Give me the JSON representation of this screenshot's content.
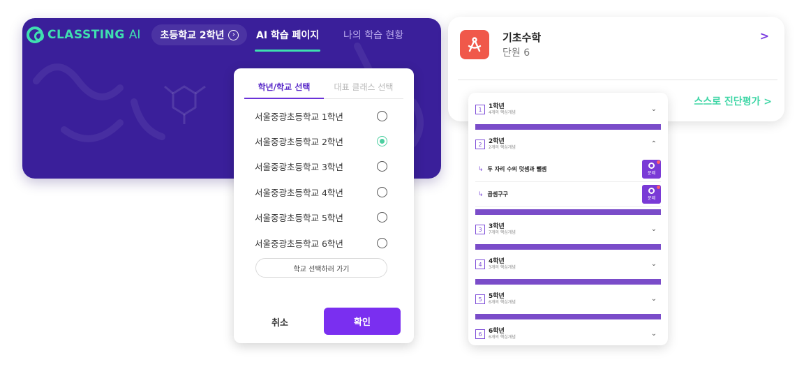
{
  "app": {
    "logo_text": "CLASSTING",
    "logo_ai": "AI",
    "grade_pill": "초등학교 2학년",
    "nav": {
      "active": "AI 학습 페이지",
      "inactive": "나의 학습 현황"
    },
    "accent_color": "#3fe0b0",
    "bg_color": "#3a1f9a"
  },
  "modal": {
    "tabs": [
      "학년/학교 선택",
      "대표 클래스 선택"
    ],
    "schools": [
      {
        "name": "서울중광초등학교 1학년",
        "selected": false
      },
      {
        "name": "서울중광초등학교 2학년",
        "selected": true
      },
      {
        "name": "서울중광초등학교 3학년",
        "selected": false
      },
      {
        "name": "서울중광초등학교 4학년",
        "selected": false
      },
      {
        "name": "서울중광초등학교 5학년",
        "selected": false
      },
      {
        "name": "서울중광초등학교 6학년",
        "selected": false
      }
    ],
    "school_select_label": "학교 선택하러 가기",
    "cancel_label": "취소",
    "confirm_label": "확인"
  },
  "course": {
    "title": "기초수학",
    "unit": "단원 6",
    "self_diagnosis": "스스로 진단평가 >",
    "chevron": ">"
  },
  "grades": [
    {
      "num": "1",
      "title": "1학년",
      "sub": "4개의 핵심개념",
      "expanded": false,
      "concepts": []
    },
    {
      "num": "2",
      "title": "2학년",
      "sub": "2개의 핵심개념",
      "expanded": true,
      "concepts": [
        {
          "name": "두 자리 수의 덧셈과 뺄셈",
          "button_label": "문제"
        },
        {
          "name": "곱셈구구",
          "button_label": "문제"
        }
      ]
    },
    {
      "num": "3",
      "title": "3학년",
      "sub": "7개의 핵심개념",
      "expanded": false,
      "concepts": []
    },
    {
      "num": "4",
      "title": "4학년",
      "sub": "3개의 핵심개념",
      "expanded": false,
      "concepts": []
    },
    {
      "num": "5",
      "title": "5학년",
      "sub": "6개의 핵심개념",
      "expanded": false,
      "concepts": []
    },
    {
      "num": "6",
      "title": "6학년",
      "sub": "6개의 핵심개념",
      "expanded": false,
      "concepts": []
    }
  ]
}
